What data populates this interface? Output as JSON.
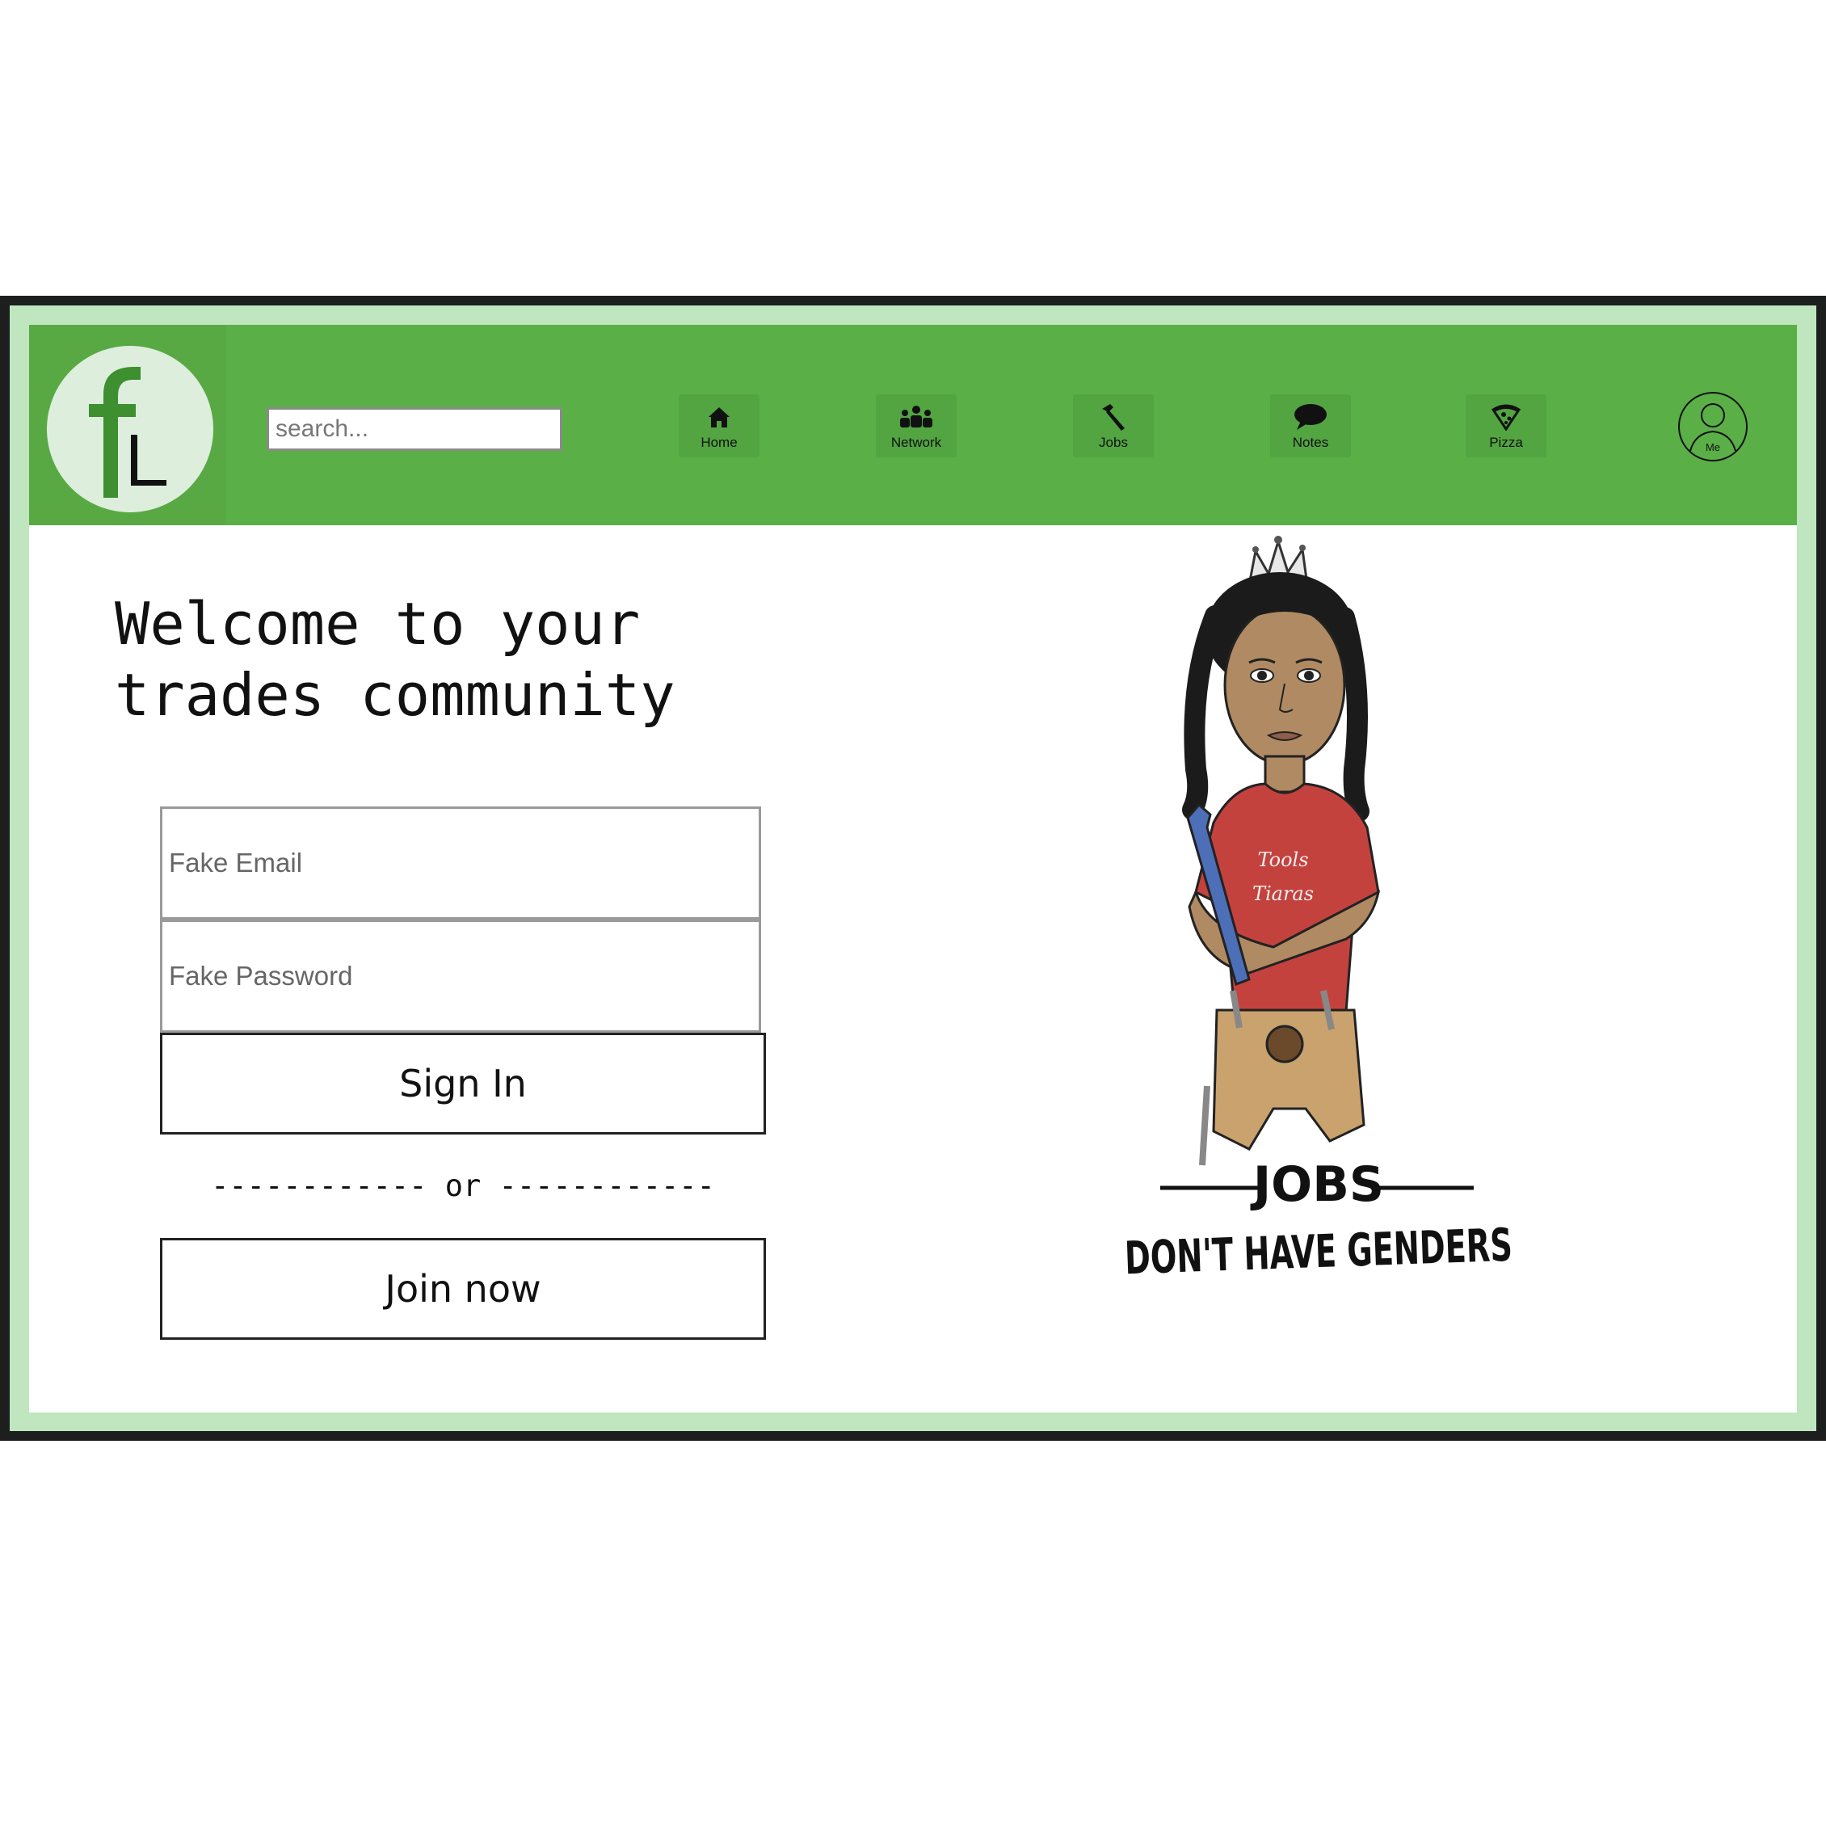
{
  "search": {
    "placeholder": "search..."
  },
  "nav": {
    "items": [
      {
        "label": "Home",
        "icon": "home-icon"
      },
      {
        "label": "Network",
        "icon": "network-icon"
      },
      {
        "label": "Jobs",
        "icon": "hammer-icon"
      },
      {
        "label": "Notes",
        "icon": "speech-bubble-icon"
      },
      {
        "label": "Pizza",
        "icon": "pizza-icon"
      }
    ],
    "profile_label": "Me"
  },
  "main": {
    "welcome_heading": "Welcome to your\ntrades community",
    "email_placeholder": "Fake Email",
    "password_placeholder": "Fake Password",
    "sign_in_label": "Sign In",
    "divider_text": "------------ or ------------",
    "join_label": "Join now"
  },
  "illustration": {
    "shirt_text": "Tools & Tiaras",
    "slogan_line1": "JOBS",
    "slogan_line2": "DON'T HAVE GENDERS"
  },
  "colors": {
    "navbar": "#5aaf47",
    "frame": "#bfe6bf",
    "logo_letters": "#3d8f30",
    "border_dark": "#1c1f1e"
  }
}
